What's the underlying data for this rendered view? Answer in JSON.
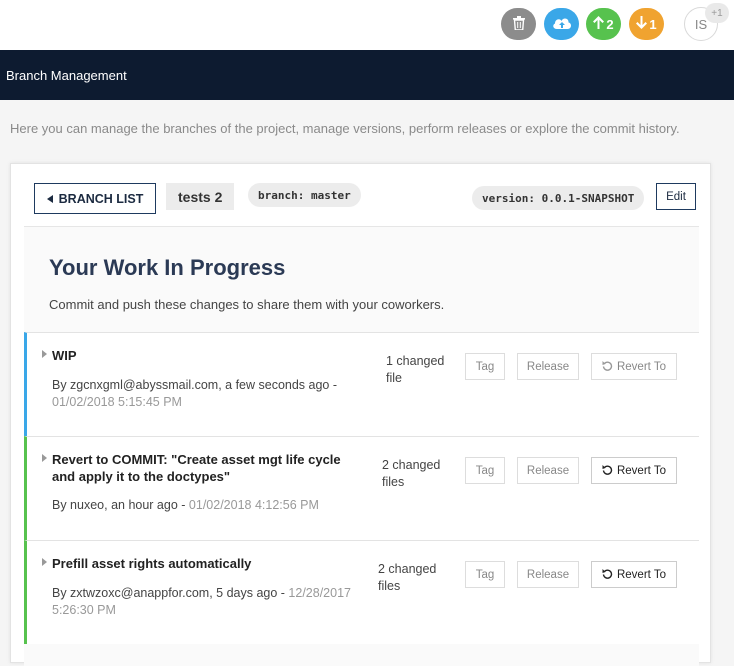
{
  "topbar": {
    "ahead_count": "2",
    "behind_count": "1",
    "avatar_initials": "IS",
    "avatar_extra": "+1"
  },
  "header": {
    "title": "Branch Management"
  },
  "intro": "Here you can manage the branches of the project, manage versions, perform releases or explore the commit history.",
  "toolbar": {
    "branch_list_label": "BRANCH LIST",
    "project_name": "tests 2",
    "branch": "branch: master",
    "version": "version: 0.0.1-SNAPSHOT",
    "edit_label": "Edit"
  },
  "wip": {
    "title": "Your Work In Progress",
    "subtitle": "Commit and push these changes to share them with your coworkers."
  },
  "commits": [
    {
      "title": "WIP",
      "author_line": "By zgcnxgml@abyssmail.com, a few seconds ago -",
      "date": "01/02/2018 5:15:45 PM",
      "changed_line1": "1 changed",
      "changed_line2": "file",
      "tag_label": "Tag",
      "release_label": "Release",
      "revert_label": "Revert To"
    },
    {
      "title": "Revert to COMMIT: \"Create asset mgt life cycle and apply it to the doctypes\"",
      "author_line": "By nuxeo, an hour ago -",
      "date": "01/02/2018 4:12:56 PM",
      "changed_line1": "2 changed",
      "changed_line2": "files",
      "tag_label": "Tag",
      "release_label": "Release",
      "revert_label": "Revert To"
    },
    {
      "title": "Prefill asset rights automatically",
      "author_line": "By zxtwzoxc@anappfor.com, 5 days ago -",
      "date": "12/28/2017 5:26:30 PM",
      "changed_line1": "2 changed",
      "changed_line2": "files",
      "tag_label": "Tag",
      "release_label": "Release",
      "revert_label": "Revert To"
    }
  ],
  "colors": {
    "header_bg": "#0d1b30",
    "trash": "#8c8c8c",
    "cloud": "#3aa7e8",
    "ahead": "#57c24e",
    "behind": "#f0a330"
  }
}
